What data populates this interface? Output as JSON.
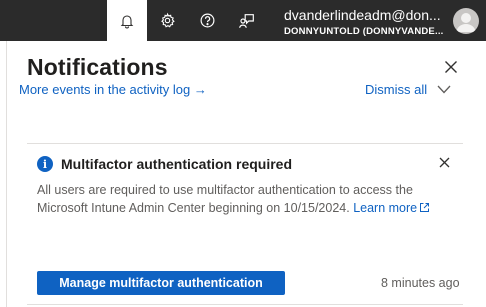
{
  "topbar": {
    "icons": {
      "notifications": "bell-icon",
      "settings": "gear-icon",
      "help": "question-icon",
      "feedback": "feedback-icon"
    },
    "account": {
      "email": "dvanderlindeadm@don...",
      "tenant": "DONNYUNTOLD (DONNYVANDE..."
    }
  },
  "panel": {
    "title": "Notifications",
    "events_link": "More events in the activity log →",
    "dismiss_all": "Dismiss all"
  },
  "notification": {
    "title": "Multifactor authentication required",
    "body": "All users are required to use multifactor authentication to access the Microsoft Intune Admin Center beginning on 10/15/2024.",
    "learn_more": "Learn more",
    "button_label": "Manage multifactor authentication",
    "time": "8 minutes ago"
  },
  "colors": {
    "accent": "#0f62c2",
    "topbar_bg": "#2b2b2b"
  }
}
